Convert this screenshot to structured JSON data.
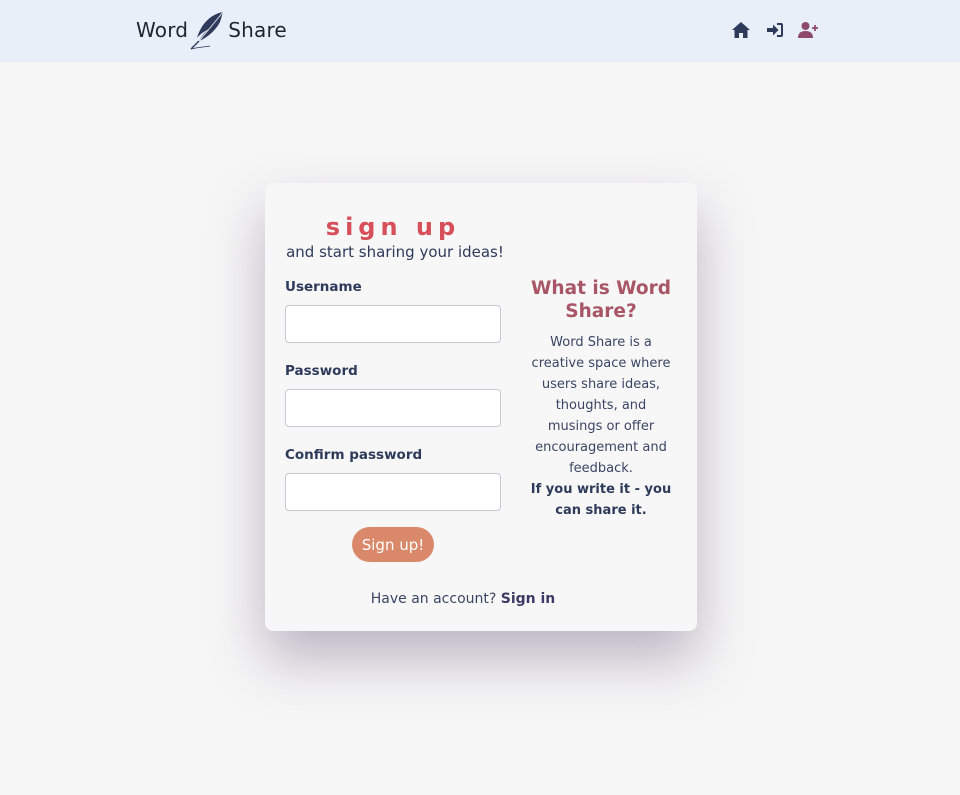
{
  "header": {
    "brand_left": "Word",
    "brand_right": "Share",
    "icons": [
      "home-icon",
      "sign-in-icon",
      "user-plus-icon"
    ]
  },
  "signup": {
    "title": "sign up",
    "subtitle": "and start sharing your ideas!",
    "username_label": "Username",
    "username_value": "",
    "password_label": "Password",
    "password_value": "",
    "confirm_label": "Confirm password",
    "confirm_value": "",
    "submit_label": "Sign up!",
    "have_account_text": "Have an account?",
    "signin_link": "Sign in"
  },
  "info": {
    "title": "What is Word Share?",
    "body": "Word Share is a creative space where users share ideas, thoughts, and musings or offer encouragement and feedback.",
    "emphasis": "If you write it - you can share it."
  },
  "colors": {
    "navbar_bg": "#e8eff9",
    "page_bg": "#f6f6f6",
    "title_accent": "#d64f59",
    "info_title": "#a85566",
    "button_bg": "#d9896a",
    "text_dark": "#2d3a5a",
    "user_plus_icon": "#8e4a6a"
  }
}
